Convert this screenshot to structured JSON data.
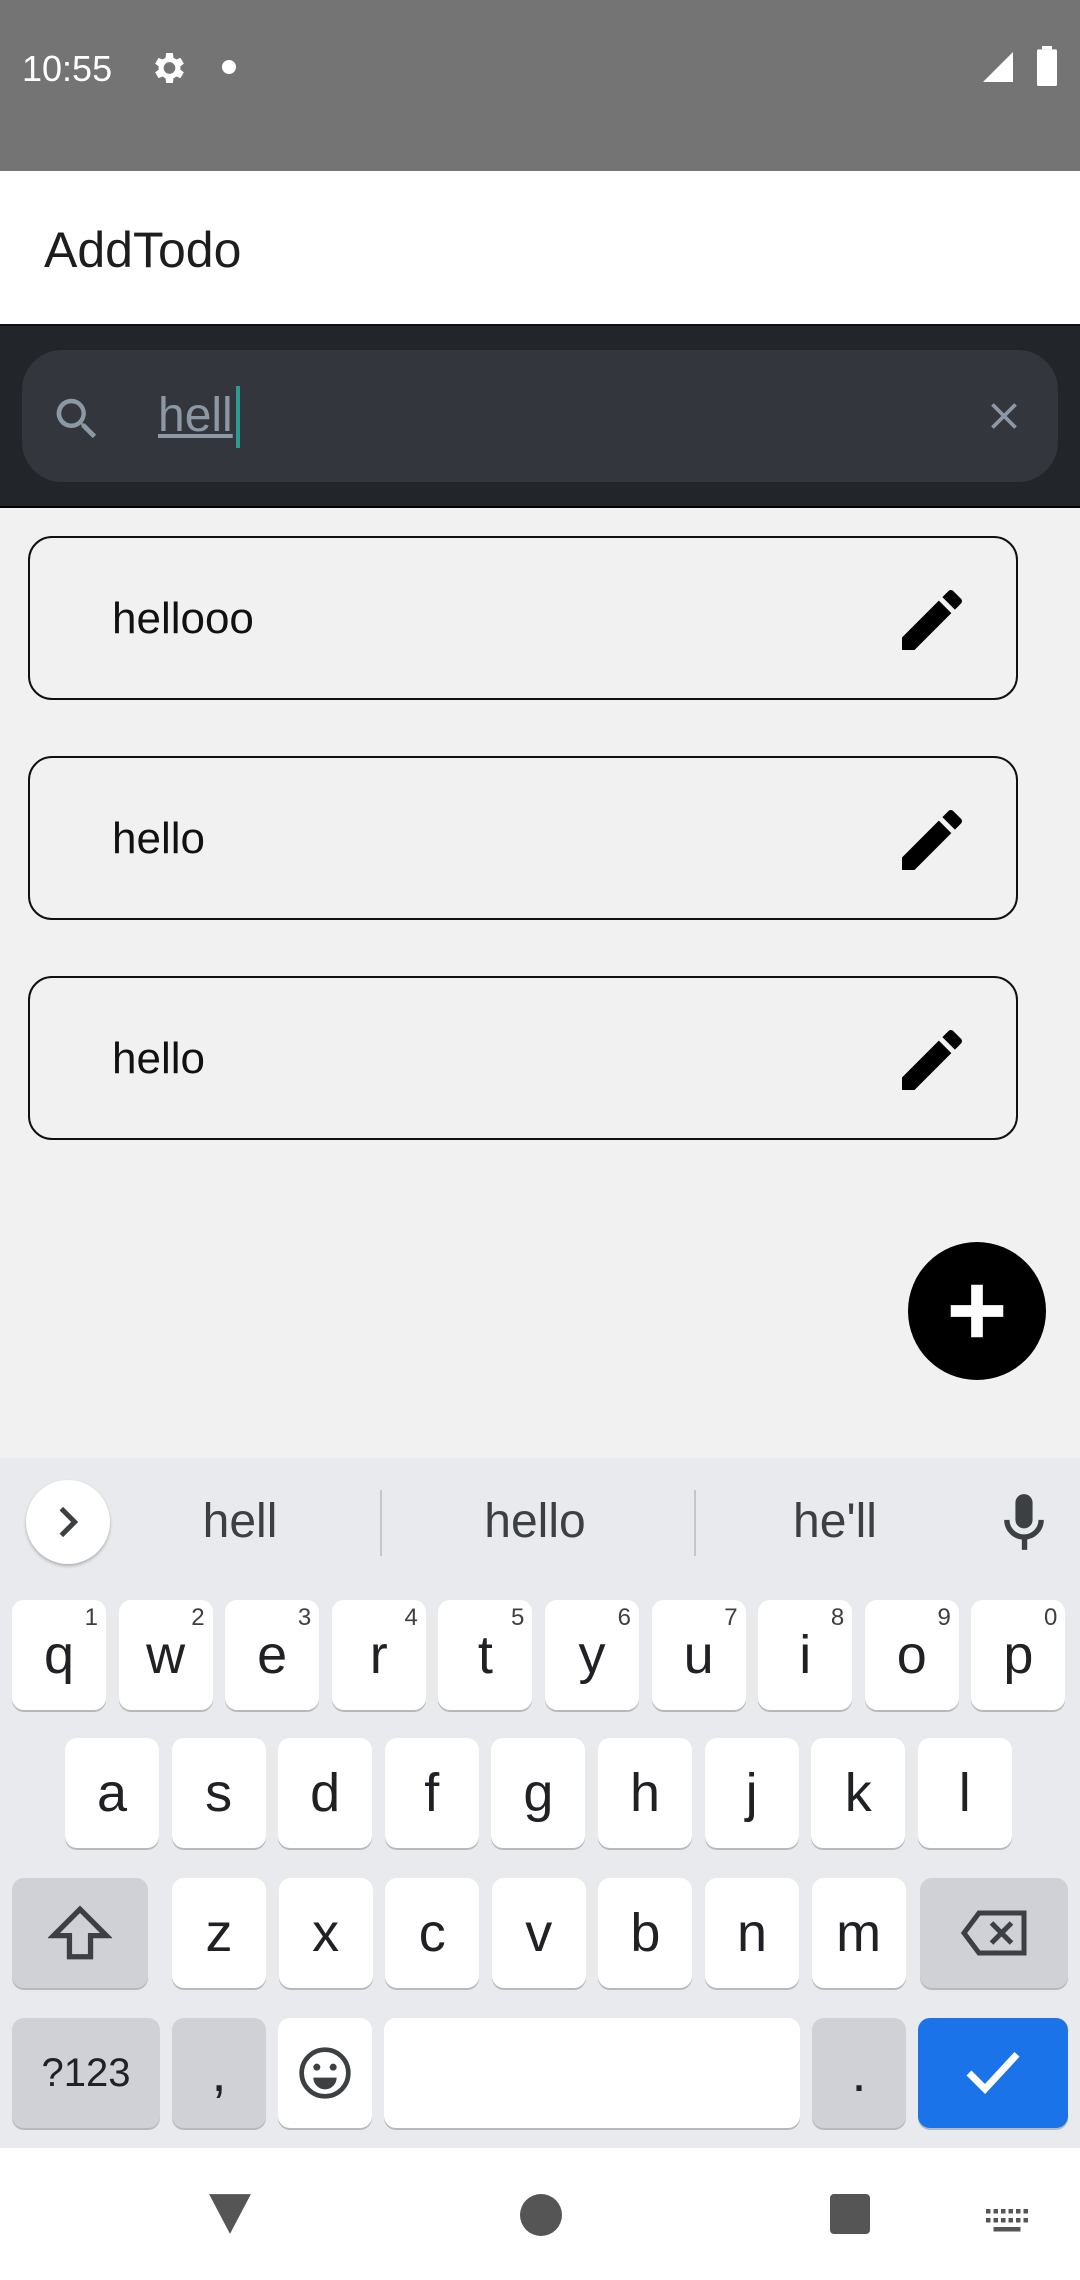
{
  "status_bar": {
    "time": "10:55"
  },
  "app_bar": {
    "title": "AddTodo"
  },
  "search": {
    "value": "hell",
    "placeholder": ""
  },
  "todos": [
    {
      "text": "hellooo"
    },
    {
      "text": "hello"
    },
    {
      "text": "hello"
    }
  ],
  "keyboard": {
    "suggestions": [
      "hell",
      "hello",
      "he'll"
    ],
    "row1": [
      {
        "k": "q",
        "h": "1"
      },
      {
        "k": "w",
        "h": "2"
      },
      {
        "k": "e",
        "h": "3"
      },
      {
        "k": "r",
        "h": "4"
      },
      {
        "k": "t",
        "h": "5"
      },
      {
        "k": "y",
        "h": "6"
      },
      {
        "k": "u",
        "h": "7"
      },
      {
        "k": "i",
        "h": "8"
      },
      {
        "k": "o",
        "h": "9"
      },
      {
        "k": "p",
        "h": "0"
      }
    ],
    "row2": [
      "a",
      "s",
      "d",
      "f",
      "g",
      "h",
      "j",
      "k",
      "l"
    ],
    "row3": [
      "z",
      "x",
      "c",
      "v",
      "b",
      "n",
      "m"
    ],
    "symbols_label": "?123",
    "comma_label": ",",
    "period_label": "."
  },
  "colors": {
    "accent": "#1a73e8",
    "caret": "#2a9d8f",
    "status_bar": "#747474",
    "search_bg": "#22262b"
  }
}
